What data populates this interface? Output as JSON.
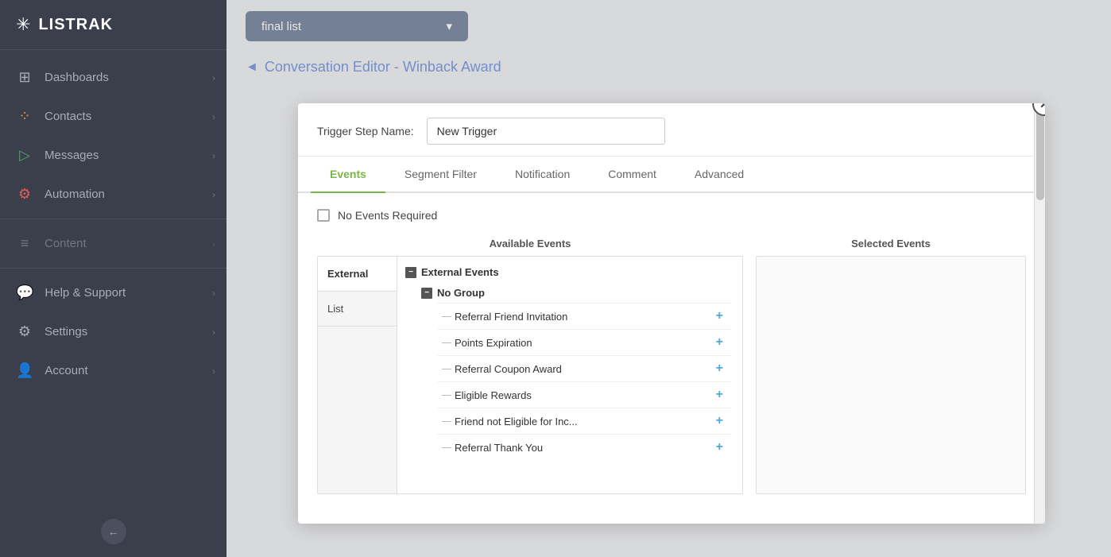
{
  "app": {
    "name": "LISTRAK"
  },
  "sidebar": {
    "items": [
      {
        "id": "dashboards",
        "label": "Dashboards",
        "icon": "⊞",
        "hasChevron": true
      },
      {
        "id": "contacts",
        "label": "Contacts",
        "icon": "⁞⁚",
        "hasChevron": true
      },
      {
        "id": "messages",
        "label": "Messages",
        "icon": "✈",
        "hasChevron": true
      },
      {
        "id": "automation",
        "label": "Automation",
        "icon": "⚙",
        "hasChevron": true
      },
      {
        "id": "content",
        "label": "Content",
        "icon": "≡",
        "hasChevron": true,
        "dimmed": true
      },
      {
        "id": "help-support",
        "label": "Help & Support",
        "icon": "💬",
        "hasChevron": true
      },
      {
        "id": "settings",
        "label": "Settings",
        "icon": "⚙",
        "hasChevron": true
      },
      {
        "id": "account",
        "label": "Account",
        "icon": "👤",
        "hasChevron": true
      }
    ]
  },
  "top_bar": {
    "list_dropdown": {
      "value": "final list",
      "placeholder": "final list"
    }
  },
  "breadcrumb": {
    "arrow": "◄",
    "text": "Conversation Editor - Winback Award"
  },
  "modal": {
    "close_label": "✕",
    "trigger_step": {
      "label": "Trigger Step Name:",
      "value": "New Trigger"
    },
    "tabs": [
      {
        "id": "events",
        "label": "Events",
        "active": true
      },
      {
        "id": "segment-filter",
        "label": "Segment Filter",
        "active": false
      },
      {
        "id": "notification",
        "label": "Notification",
        "active": false
      },
      {
        "id": "comment",
        "label": "Comment",
        "active": false
      },
      {
        "id": "advanced",
        "label": "Advanced",
        "active": false
      }
    ],
    "no_events_required": {
      "label": "No Events Required",
      "checked": false
    },
    "available_events": {
      "title": "Available Events",
      "categories": [
        {
          "id": "external",
          "label": "External",
          "active": true
        },
        {
          "id": "list",
          "label": "List",
          "active": false
        }
      ],
      "tree": {
        "group": {
          "label": "External Events",
          "subgroups": [
            {
              "label": "No Group",
              "items": [
                {
                  "label": "Referral Friend Invitation"
                },
                {
                  "label": "Points Expiration"
                },
                {
                  "label": "Referral Coupon Award"
                },
                {
                  "label": "Eligible Rewards"
                },
                {
                  "label": "Friend not Eligible for Inc..."
                },
                {
                  "label": "Referral Thank You"
                }
              ]
            }
          ]
        }
      }
    },
    "selected_events": {
      "title": "Selected Events"
    }
  }
}
